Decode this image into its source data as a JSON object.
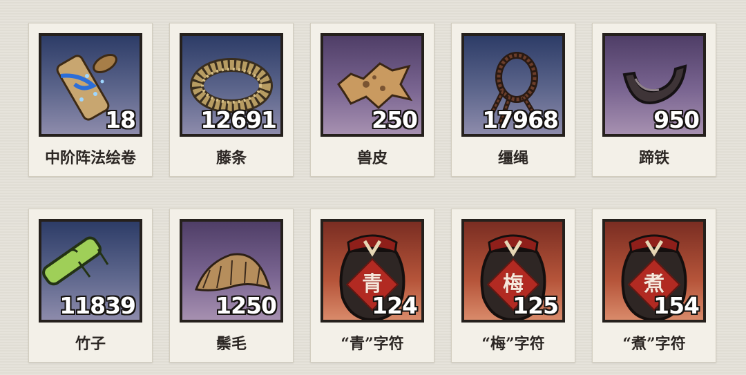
{
  "inventory": {
    "items": [
      {
        "name": "中阶阵法绘卷",
        "count": "18",
        "icon": "scroll-icon",
        "bg": "blue"
      },
      {
        "name": "藤条",
        "count": "12691",
        "icon": "rattan-coil-icon",
        "bg": "blue"
      },
      {
        "name": "兽皮",
        "count": "250",
        "icon": "animal-hide-icon",
        "bg": "purple"
      },
      {
        "name": "缰绳",
        "count": "17968",
        "icon": "rope-icon",
        "bg": "blue"
      },
      {
        "name": "蹄铁",
        "count": "950",
        "icon": "horseshoe-icon",
        "bg": "purple"
      },
      {
        "name": "竹子",
        "count": "11839",
        "icon": "bamboo-icon",
        "bg": "blue"
      },
      {
        "name": "鬃毛",
        "count": "1250",
        "icon": "mane-icon",
        "bg": "purple"
      },
      {
        "name": "“青”字符",
        "count": "124",
        "icon": "wine-jar-icon",
        "bg": "red",
        "seal": "青"
      },
      {
        "name": "“梅”字符",
        "count": "125",
        "icon": "wine-jar-icon",
        "bg": "red",
        "seal": "梅"
      },
      {
        "name": "“煮”字符",
        "count": "154",
        "icon": "wine-jar-icon",
        "bg": "red",
        "seal": "煮"
      }
    ]
  },
  "colors": {
    "page_bg": "#e4e1d8",
    "card_bg": "#f3f0e8",
    "frame": "#25201c",
    "count_text": "#ffffff",
    "name_text": "#2b2623"
  }
}
